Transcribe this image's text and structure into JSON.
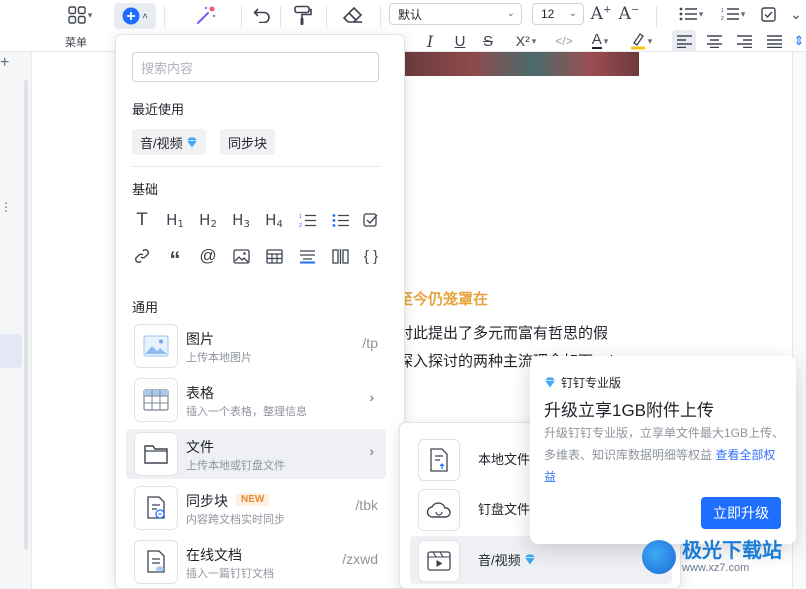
{
  "toolbar": {
    "menu_label": "菜单",
    "font_family": "默认",
    "font_size": "12",
    "superscript": "X²",
    "font_color_letter": "A"
  },
  "insert_menu": {
    "search_placeholder": "搜索内容",
    "recent_title": "最近使用",
    "recent": [
      {
        "label": "音/视频"
      },
      {
        "label": "同步块"
      }
    ],
    "basic_title": "基础",
    "general_title": "通用",
    "items": [
      {
        "title": "图片",
        "sub": "上传本地图片",
        "shortcut": "/tp"
      },
      {
        "title": "表格",
        "sub": "插入一个表格，整理信息",
        "shortcut": ""
      },
      {
        "title": "文件",
        "sub": "上传本地或钉盘文件",
        "shortcut": ""
      },
      {
        "title": "同步块",
        "sub": "内容跨文档实时同步",
        "shortcut": "/tbk",
        "badge": "NEW"
      },
      {
        "title": "在线文档",
        "sub": "插入一篇钉钉文档",
        "shortcut": "/zxwd"
      }
    ]
  },
  "file_submenu": {
    "items": [
      {
        "label": "本地文件"
      },
      {
        "label": "钉盘文件"
      },
      {
        "label": "音/视频"
      }
    ]
  },
  "upgrade": {
    "tag": "钉钉专业版",
    "title": "升级立享1GB附件上传",
    "desc": "升级钉钉专业版，立享单文件最大1GB上传、多维表、知识库数据明细等权益",
    "link": "查看全部权益",
    "button": "立即升级"
  },
  "document": {
    "heading_fragment": "至今仍笼罩在",
    "line1": "对此提出了多元而富有哲思的假",
    "line2": "深入探讨的两种主流理念如下：/"
  },
  "watermark": {
    "brand": "极光下载站",
    "url": "www.xz7.com"
  },
  "colors": {
    "accent": "#1e6fff",
    "heading": "#e8a33d",
    "diamond": "#3fa9f5"
  }
}
